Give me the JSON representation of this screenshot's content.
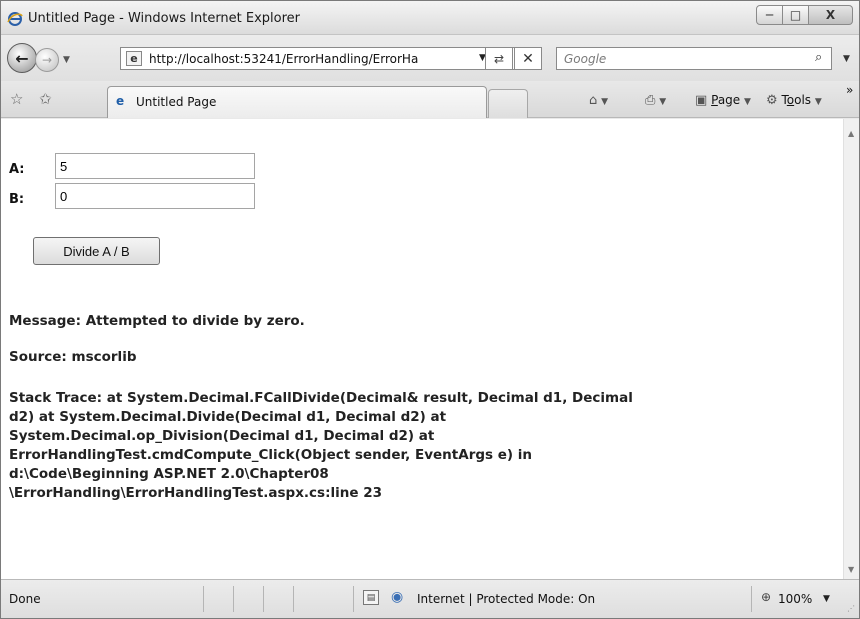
{
  "window": {
    "title": "Untitled Page - Windows Internet Explorer",
    "minimize_glyph": "─",
    "maximize_glyph": "□",
    "close_glyph": "X"
  },
  "nav": {
    "back_glyph": "←",
    "forward_glyph": "→",
    "address_url": "http://localhost:53241/ErrorHandling/ErrorHa",
    "refresh_glyph": "⇄",
    "stop_glyph": "✕",
    "search_placeholder": "Google",
    "search_glyph": "⌕",
    "dropdown_glyph": "▼"
  },
  "tabs": {
    "favorites_glyph": "☆",
    "add_favorites_glyph": "✩",
    "active_tab": "Untitled Page"
  },
  "commands": {
    "home_glyph": "⌂",
    "print_glyph": "⎙",
    "page_glyph": "▣",
    "tools_glyph": "⚙",
    "page_label_u": "P",
    "page_label_rest": "age",
    "tools_label_pre": "T",
    "tools_label_u": "o",
    "tools_label_rest": "ols",
    "overflow_glyph": "»"
  },
  "form": {
    "a_label": "A:",
    "a_value": "5",
    "b_label": "B:",
    "b_value": "0",
    "button_label": "Divide A / B"
  },
  "output": {
    "message": "Message: Attempted to divide by zero.",
    "source": "Source: mscorlib",
    "stack_lines": [
      "Stack Trace: at System.Decimal.FCallDivide(Decimal& result, Decimal d1, Decimal",
      "d2) at System.Decimal.Divide(Decimal d1, Decimal d2) at",
      "System.Decimal.op_Division(Decimal d1, Decimal d2) at",
      "ErrorHandlingTest.cmdCompute_Click(Object sender, EventArgs e) in",
      "d:\\Code\\Beginning ASP.NET 2.0\\Chapter08",
      "\\ErrorHandling\\ErrorHandlingTest.aspx.cs:line 23"
    ]
  },
  "status": {
    "text": "Done",
    "zone": "Internet | Protected Mode: On",
    "zoom": "100%",
    "zoom_glyph": "⊕",
    "blocked_glyph": "▤",
    "globe_glyph": "◉",
    "grip_glyph": "⋰"
  },
  "scroll": {
    "up_glyph": "▲",
    "down_glyph": "▼"
  }
}
